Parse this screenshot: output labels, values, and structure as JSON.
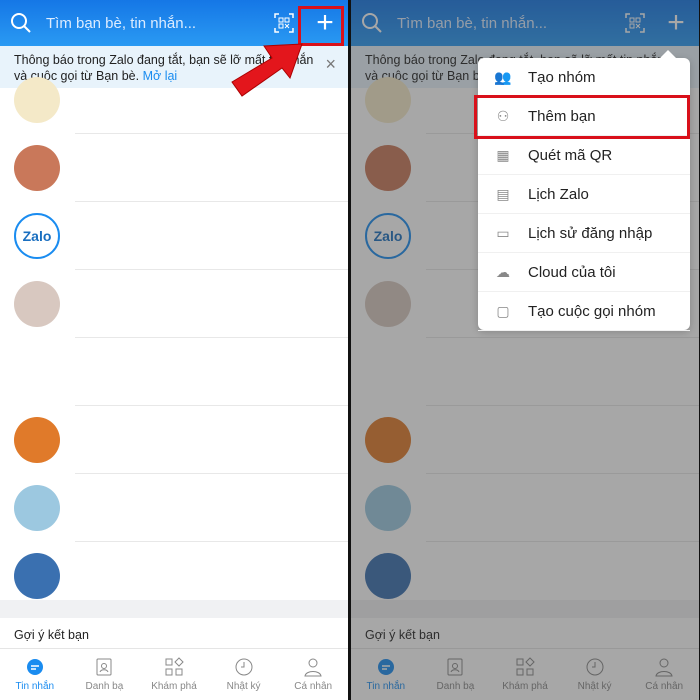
{
  "header": {
    "search_placeholder": "Tìm bạn bè, tin nhắn...",
    "plus": "+"
  },
  "banner": {
    "text": "Thông báo trong Zalo đang tắt, bạn sẽ lỡ mất tin nhắn và cuộc gọi từ Bạn bè.",
    "link": "Mở lại",
    "close": "×"
  },
  "conversations": [
    {
      "avatar": "science-logo",
      "color": "#f4e9c8"
    },
    {
      "avatar": "cartoon-girl",
      "color": "#c9785a"
    },
    {
      "avatar": "zalo-logo",
      "color": "#ffffff",
      "label": "Zalo"
    },
    {
      "avatar": "group-photos",
      "color": "#d8c8c0"
    },
    {
      "avatar": "green-cross",
      "color": "#ffffff"
    },
    {
      "avatar": "orange-flower-logo",
      "color": "#e07a2a"
    },
    {
      "avatar": "blue-badge-logo",
      "color": "#9cc8e0"
    },
    {
      "avatar": "5k-logo",
      "color": "#3a70b0"
    }
  ],
  "suggestions_title": "Gợi ý kết bạn",
  "nav": [
    {
      "label": "Tin nhắn",
      "icon": "chat-icon",
      "active": true
    },
    {
      "label": "Danh bạ",
      "icon": "contacts-icon"
    },
    {
      "label": "Khám phá",
      "icon": "discover-icon"
    },
    {
      "label": "Nhật ký",
      "icon": "clock-icon"
    },
    {
      "label": "Cá nhân",
      "icon": "person-icon"
    }
  ],
  "menu": [
    {
      "label": "Tạo nhóm",
      "icon": "group-add-icon",
      "glyph": "👥"
    },
    {
      "label": "Thêm bạn",
      "icon": "person-add-icon",
      "glyph": "⚇",
      "highlighted": true
    },
    {
      "label": "Quét mã QR",
      "icon": "qr-icon",
      "glyph": "▦"
    },
    {
      "label": "Lịch Zalo",
      "icon": "calendar-icon",
      "glyph": "▤"
    },
    {
      "label": "Lịch sử đăng nhập",
      "icon": "monitor-icon",
      "glyph": "▭"
    },
    {
      "label": "Cloud của tôi",
      "icon": "cloud-icon",
      "glyph": "☁"
    },
    {
      "label": "Tạo cuộc gọi nhóm",
      "icon": "video-call-icon",
      "glyph": "▢"
    }
  ],
  "colors": {
    "brand": "#1a8cf0",
    "highlight": "#d9101a"
  }
}
